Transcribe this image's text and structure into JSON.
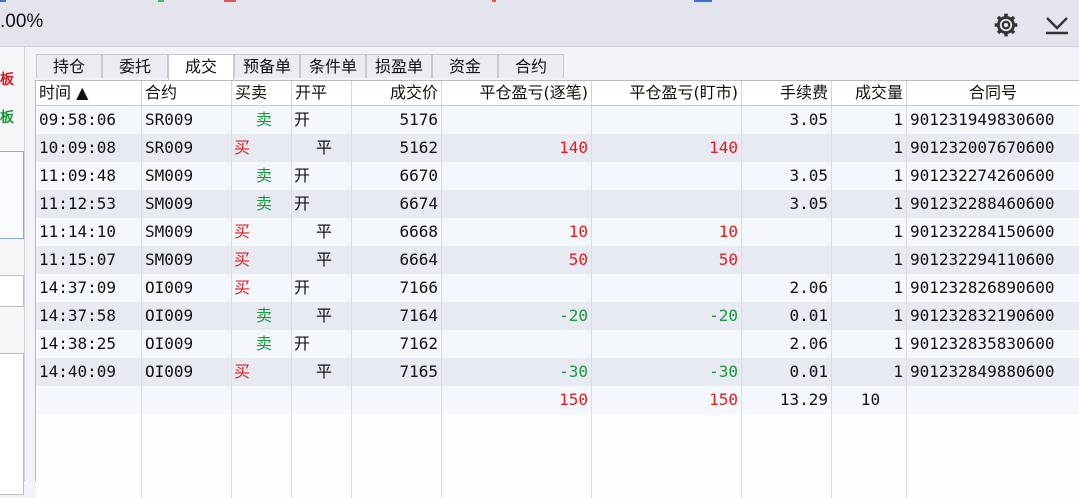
{
  "header": {
    "pct_text": ".00%"
  },
  "left_panel": {
    "label1": "板",
    "label2": "板"
  },
  "tabs": [
    {
      "label": "持仓"
    },
    {
      "label": "委托"
    },
    {
      "label": "成交",
      "active": true
    },
    {
      "label": "预备单"
    },
    {
      "label": "条件单"
    },
    {
      "label": "损盈单"
    },
    {
      "label": "资金"
    },
    {
      "label": "合约"
    }
  ],
  "columns": [
    {
      "label": "时间 ▲"
    },
    {
      "label": "合约"
    },
    {
      "label": "买卖"
    },
    {
      "label": "开平"
    },
    {
      "label": "成交价"
    },
    {
      "label": "平仓盈亏(逐笔)"
    },
    {
      "label": "平仓盈亏(盯市)"
    },
    {
      "label": "手续费"
    },
    {
      "label": "成交量"
    },
    {
      "label": "合同号"
    }
  ],
  "rows": [
    {
      "time": "09:58:06",
      "contract": "SR009",
      "side": "卖",
      "oc": "开",
      "price": "5176",
      "pnl_trade": "",
      "pnl_mtm": "",
      "fee": "3.05",
      "qty": "1",
      "order_id": "901231949830600"
    },
    {
      "time": "10:09:08",
      "contract": "SR009",
      "side": "买",
      "oc": "平",
      "price": "5162",
      "pnl_trade": "140",
      "pnl_mtm": "140",
      "fee": "",
      "qty": "1",
      "order_id": "901232007670600"
    },
    {
      "time": "11:09:48",
      "contract": "SM009",
      "side": "卖",
      "oc": "开",
      "price": "6670",
      "pnl_trade": "",
      "pnl_mtm": "",
      "fee": "3.05",
      "qty": "1",
      "order_id": "901232274260600"
    },
    {
      "time": "11:12:53",
      "contract": "SM009",
      "side": "卖",
      "oc": "开",
      "price": "6674",
      "pnl_trade": "",
      "pnl_mtm": "",
      "fee": "3.05",
      "qty": "1",
      "order_id": "901232288460600"
    },
    {
      "time": "11:14:10",
      "contract": "SM009",
      "side": "买",
      "oc": "平",
      "price": "6668",
      "pnl_trade": "10",
      "pnl_mtm": "10",
      "fee": "",
      "qty": "1",
      "order_id": "901232284150600"
    },
    {
      "time": "11:15:07",
      "contract": "SM009",
      "side": "买",
      "oc": "平",
      "price": "6664",
      "pnl_trade": "50",
      "pnl_mtm": "50",
      "fee": "",
      "qty": "1",
      "order_id": "901232294110600"
    },
    {
      "time": "14:37:09",
      "contract": "OI009",
      "side": "买",
      "oc": "开",
      "price": "7166",
      "pnl_trade": "",
      "pnl_mtm": "",
      "fee": "2.06",
      "qty": "1",
      "order_id": "901232826890600"
    },
    {
      "time": "14:37:58",
      "contract": "OI009",
      "side": "卖",
      "oc": "平",
      "price": "7164",
      "pnl_trade": "-20",
      "pnl_mtm": "-20",
      "fee": "0.01",
      "qty": "1",
      "order_id": "901232832190600"
    },
    {
      "time": "14:38:25",
      "contract": "OI009",
      "side": "卖",
      "oc": "开",
      "price": "7162",
      "pnl_trade": "",
      "pnl_mtm": "",
      "fee": "2.06",
      "qty": "1",
      "order_id": "901232835830600"
    },
    {
      "time": "14:40:09",
      "contract": "OI009",
      "side": "买",
      "oc": "平",
      "price": "7165",
      "pnl_trade": "-30",
      "pnl_mtm": "-30",
      "fee": "0.01",
      "qty": "1",
      "order_id": "901232849880600"
    }
  ],
  "totals": {
    "pnl_trade": "150",
    "pnl_mtm": "150",
    "fee": "13.29",
    "qty": "10"
  },
  "colors": {
    "buy": "#e0201f",
    "sell": "#1a9a3a",
    "profit": "#e0201f",
    "loss": "#1a9a3a"
  },
  "icons": {
    "settings": "gear-icon",
    "collapse": "collapse-down-icon"
  }
}
